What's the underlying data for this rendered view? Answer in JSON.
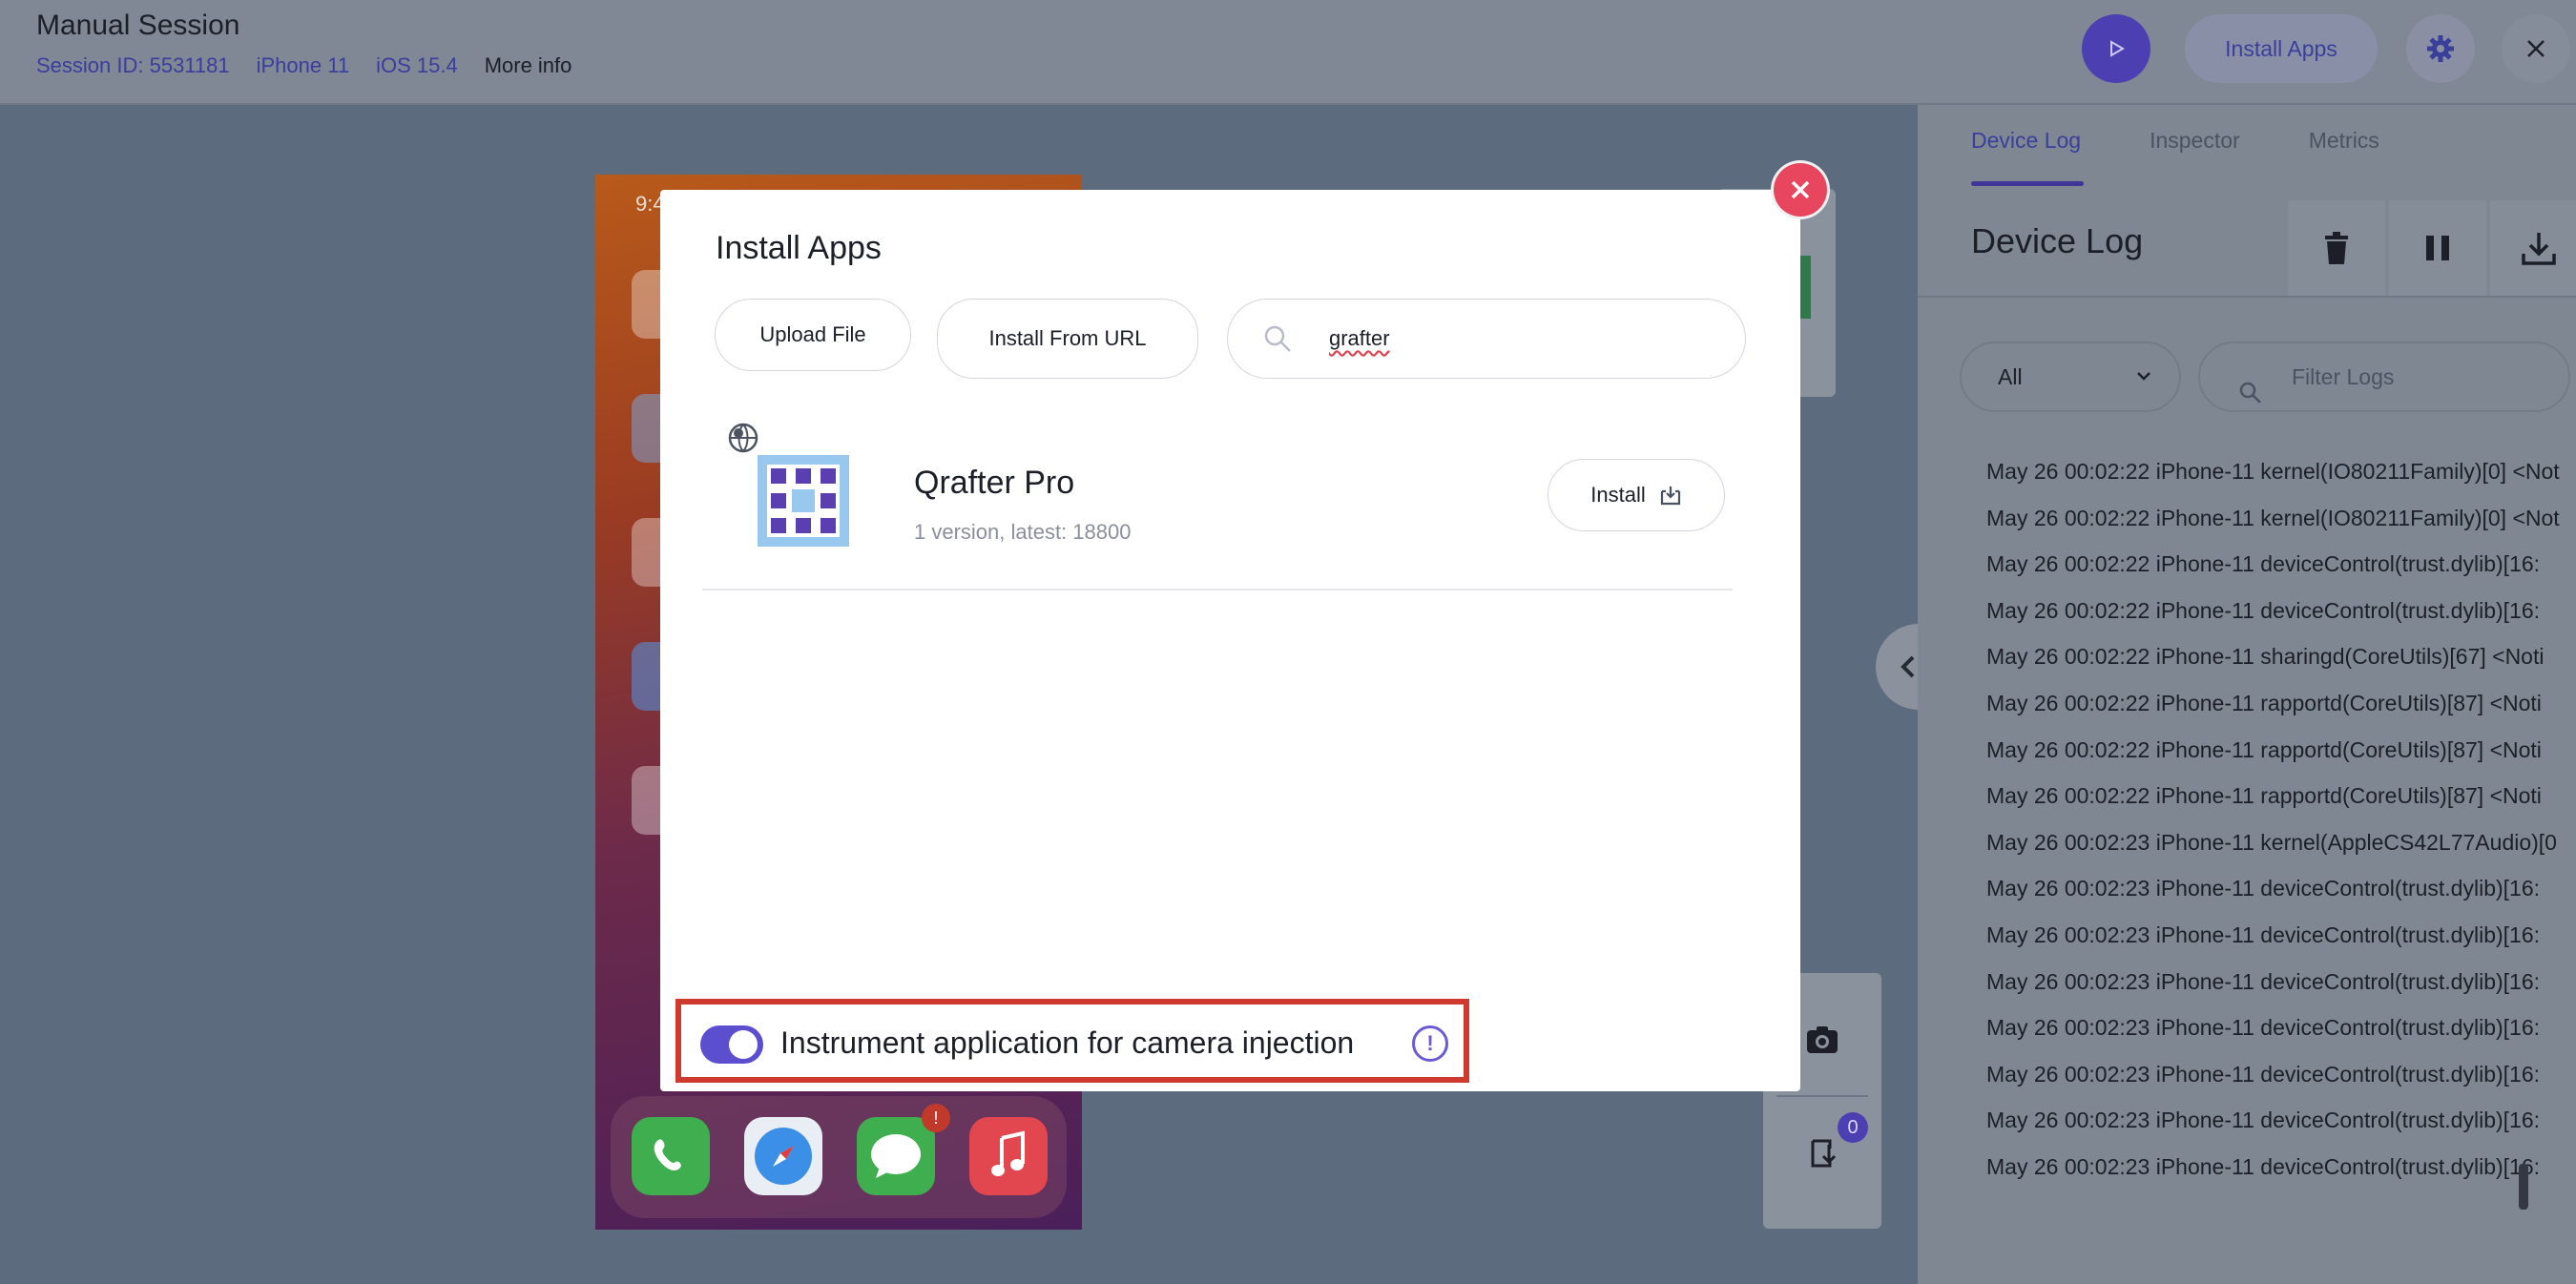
{
  "header": {
    "title": "Manual Session",
    "session_id": "Session ID: 5531181",
    "device": "iPhone 11",
    "os": "iOS 15.4",
    "more_info": "More info",
    "install_apps_label": "Install Apps"
  },
  "device_screen": {
    "time": "9:4",
    "messages_badge": "!"
  },
  "side_tools": {
    "file_count": "0"
  },
  "right_panel": {
    "tabs": [
      "Device Log",
      "Inspector",
      "Metrics"
    ],
    "active_tab": "Device Log",
    "title": "Device Log",
    "filter_level": "All",
    "filter_placeholder": "Filter Logs",
    "log_lines": [
      "May 26 00:02:22 iPhone-11 kernel(IO80211Family)[0] <Not",
      "May 26 00:02:22 iPhone-11 kernel(IO80211Family)[0] <Not",
      "May 26 00:02:22 iPhone-11 deviceControl(trust.dylib)[16:",
      "May 26 00:02:22 iPhone-11 deviceControl(trust.dylib)[16:",
      "May 26 00:02:22 iPhone-11 sharingd(CoreUtils)[67] <Noti",
      "May 26 00:02:22 iPhone-11 rapportd(CoreUtils)[87] <Noti",
      "May 26 00:02:22 iPhone-11 rapportd(CoreUtils)[87] <Noti",
      "May 26 00:02:22 iPhone-11 rapportd(CoreUtils)[87] <Noti",
      "May 26 00:02:23 iPhone-11 kernel(AppleCS42L77Audio)[0",
      "May 26 00:02:23 iPhone-11 deviceControl(trust.dylib)[16:",
      "May 26 00:02:23 iPhone-11 deviceControl(trust.dylib)[16:",
      "May 26 00:02:23 iPhone-11 deviceControl(trust.dylib)[16:",
      "May 26 00:02:23 iPhone-11 deviceControl(trust.dylib)[16:",
      "May 26 00:02:23 iPhone-11 deviceControl(trust.dylib)[16:",
      "May 26 00:02:23 iPhone-11 deviceControl(trust.dylib)[16:",
      "May 26 00:02:23 iPhone-11 deviceControl(trust.dylib)[16:"
    ]
  },
  "modal": {
    "title": "Install Apps",
    "upload_label": "Upload File",
    "url_label": "Install From URL",
    "search_value": "grafter",
    "result": {
      "name": "Qrafter Pro",
      "subtitle": "1 version, latest: 18800",
      "install_label": "Install"
    },
    "instrument_label": "Instrument application for camera injection",
    "instrument_enabled": true,
    "info_glyph": "!"
  },
  "colors": {
    "accent": "#5b4fd0",
    "close_red": "#e8455f",
    "highlight_border": "#cf3a2f"
  }
}
